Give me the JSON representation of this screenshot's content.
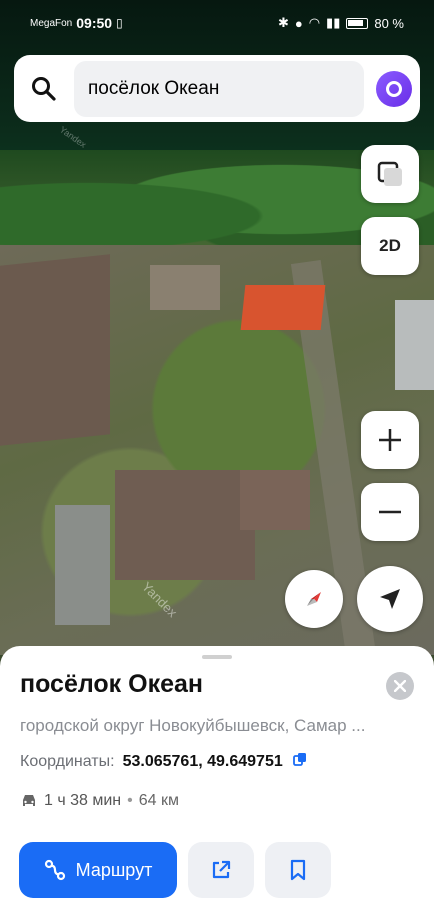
{
  "status_bar": {
    "carrier": "MegaFon",
    "time": "09:50",
    "battery": "80 %"
  },
  "search": {
    "query": "посёлок Океан"
  },
  "map": {
    "watermark": "Yandex",
    "mode_label": "2D"
  },
  "place": {
    "title": "посёлок Океан",
    "address": "городской округ Новокуйбышевск, Самар ...",
    "coords_label": "Координаты:",
    "coords_value": "53.065761, 49.649751",
    "route_time": "1 ч 38 мин",
    "route_separator": "•",
    "route_distance": "64 км"
  },
  "actions": {
    "route_label": "Маршрут"
  },
  "colors": {
    "accent": "#1a6cf5",
    "alice": "#7b46f6",
    "roof": "#d8542f"
  }
}
